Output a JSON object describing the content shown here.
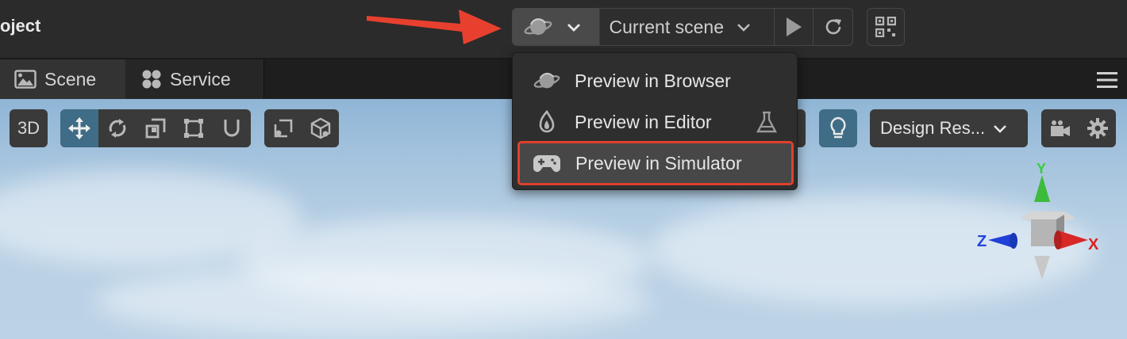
{
  "window": {
    "title": "oject"
  },
  "preview_bar": {
    "scene_select_label": "Current scene",
    "preview_icon": "planet-icon",
    "dropdown_icon": "chevron-down-icon",
    "play_icon": "play-icon",
    "refresh_icon": "refresh-icon",
    "qr_icon": "qr-code-icon"
  },
  "tabs": [
    {
      "label": "Scene",
      "icon": "image-icon"
    },
    {
      "label": "Service",
      "icon": "clover-icon"
    }
  ],
  "viewport_toolbar": {
    "mode_label": "3D",
    "design_resolution_label": "Design Res...",
    "tools": [
      "move-icon",
      "rotate-icon",
      "scale-icon",
      "rect-icon",
      "snap-icon"
    ]
  },
  "preview_menu": {
    "items": [
      {
        "label": "Preview in Browser",
        "icon": "planet-icon"
      },
      {
        "label": "Preview in Editor",
        "icon": "flame-icon",
        "trailing_icon": "flask-icon"
      },
      {
        "label": "Preview in Simulator",
        "icon": "gamepad-icon",
        "highlighted": true
      }
    ]
  },
  "gizmo": {
    "x_label": "X",
    "y_label": "Y",
    "z_label": "Z"
  },
  "colors": {
    "accent_active": "#3f6c86",
    "highlight_border": "#e0402f",
    "annotation_arrow": "#e8402e"
  }
}
